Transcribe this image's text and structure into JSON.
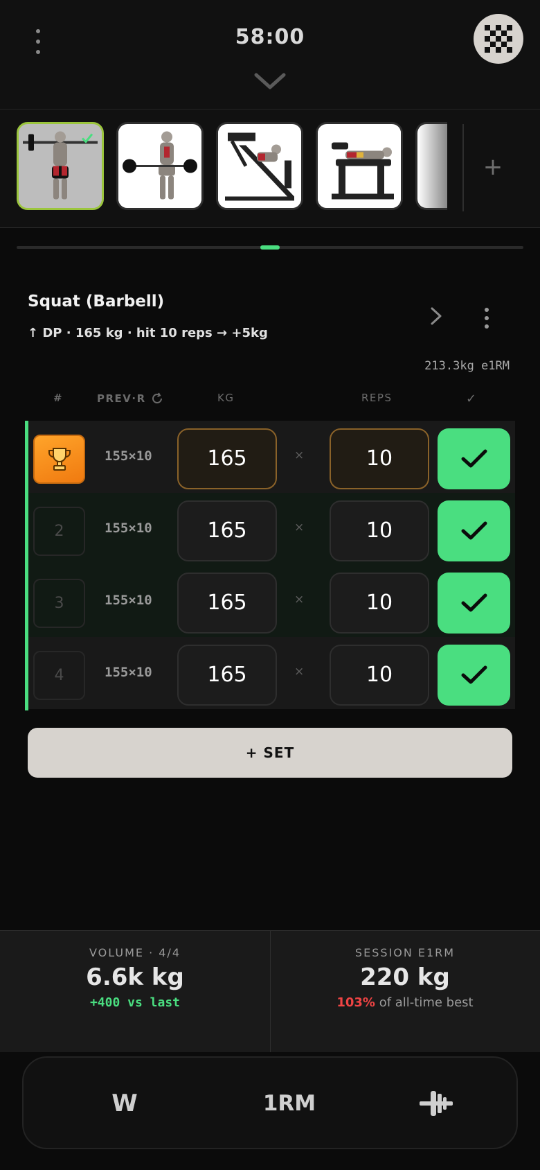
{
  "header": {
    "timer": "58:00"
  },
  "exercise_strip": {
    "thumbnails": [
      {
        "name": "Squat (Barbell)",
        "active": true
      },
      {
        "name": "Barbell Row",
        "active": false
      },
      {
        "name": "Leg Press",
        "active": false
      },
      {
        "name": "Leg Curl",
        "active": false
      },
      {
        "name": "Next exercise",
        "active": false
      }
    ],
    "add_label": "+"
  },
  "exercise": {
    "title": "Squat (Barbell)",
    "subtitle": "↑ DP · 165 kg · hit 10 reps → +5kg",
    "e1rm": "213.3kg e1RM"
  },
  "table": {
    "headers": {
      "number": "#",
      "prev": "PREV·R",
      "kg": "KG",
      "reps": "REPS",
      "check": "✓"
    },
    "sets": [
      {
        "number": "🏆",
        "prev": "155×10",
        "kg": "165",
        "times": "×",
        "reps": "10",
        "done": true,
        "pr": true
      },
      {
        "number": "2",
        "prev": "155×10",
        "kg": "165",
        "times": "×",
        "reps": "10",
        "done": true
      },
      {
        "number": "3",
        "prev": "155×10",
        "kg": "165",
        "times": "×",
        "reps": "10",
        "done": true
      },
      {
        "number": "4",
        "prev": "155×10",
        "kg": "165",
        "times": "×",
        "reps": "10",
        "done": true
      }
    ]
  },
  "add_set_label": "+ SET",
  "summary": {
    "volume": {
      "label": "VOLUME · 4/4",
      "value": "6.6k kg",
      "delta": "+400 vs last"
    },
    "session_e1rm": {
      "label": "SESSION E1RM",
      "value": "220 kg",
      "percent": "103%",
      "percent_suffix": " of all-time best"
    }
  },
  "bottom_nav": {
    "w_label": "W",
    "rm_label": "1RM",
    "plate_icon": "barbell-plate-icon"
  },
  "colors": {
    "accent_green": "#4ade80",
    "trophy_orange": "#f7931e",
    "active_thumb_border": "#9bc53d",
    "danger_red": "#ef4444"
  }
}
